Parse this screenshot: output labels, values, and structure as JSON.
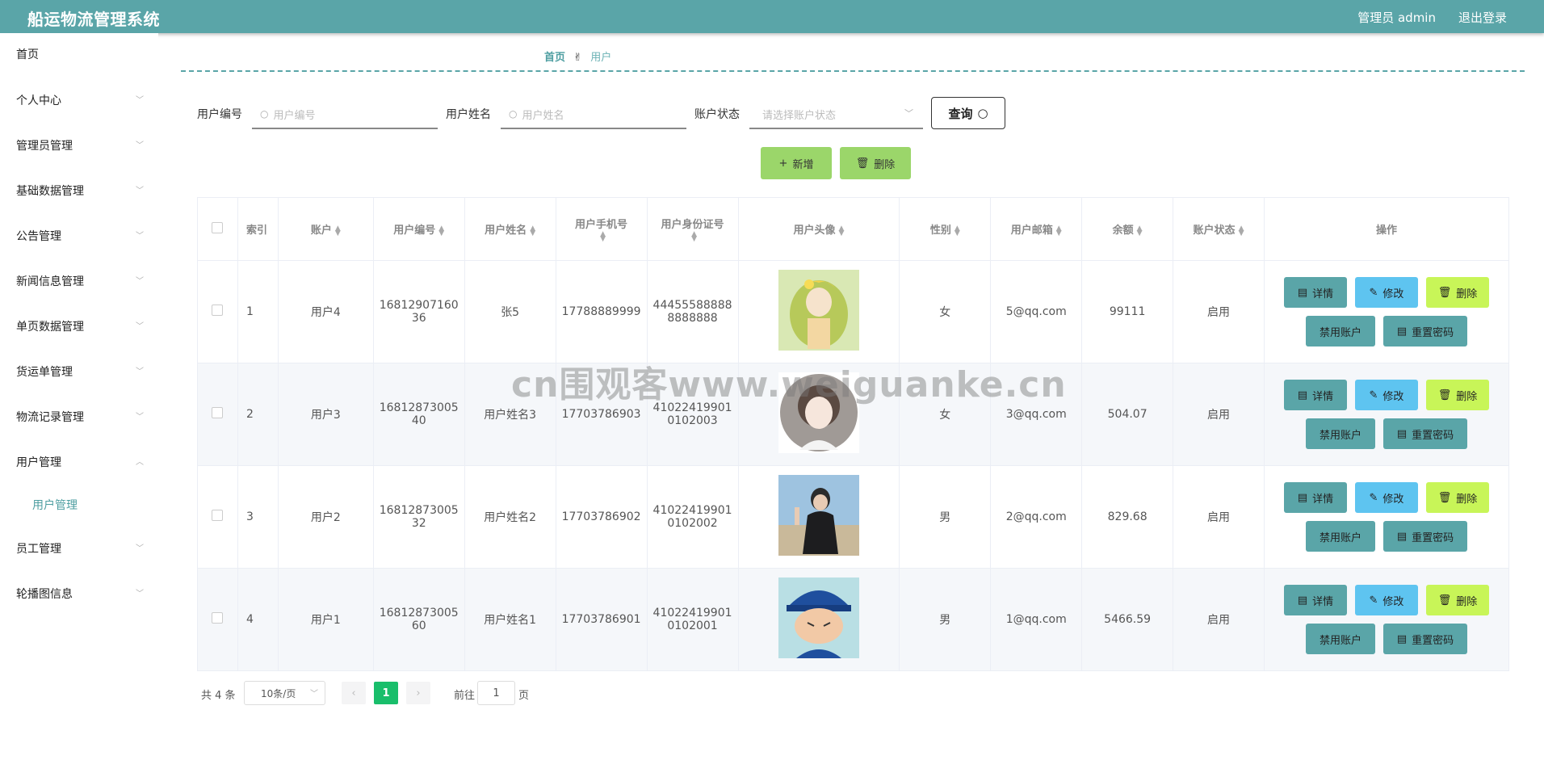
{
  "header": {
    "title": "船运物流管理系统",
    "admin": "管理员 admin",
    "logout": "退出登录"
  },
  "sidebar": {
    "items": [
      {
        "label": "首页",
        "chevron": ""
      },
      {
        "label": "个人中心",
        "chevron": "﹀"
      },
      {
        "label": "管理员管理",
        "chevron": "﹀"
      },
      {
        "label": "基础数据管理",
        "chevron": "﹀"
      },
      {
        "label": "公告管理",
        "chevron": "﹀"
      },
      {
        "label": "新闻信息管理",
        "chevron": "﹀"
      },
      {
        "label": "单页数据管理",
        "chevron": "﹀"
      },
      {
        "label": "货运单管理",
        "chevron": "﹀"
      },
      {
        "label": "物流记录管理",
        "chevron": "﹀"
      },
      {
        "label": "用户管理",
        "chevron": "︿"
      },
      {
        "label": "用户管理",
        "chevron": "",
        "sub": true
      },
      {
        "label": "员工管理",
        "chevron": "﹀"
      },
      {
        "label": "轮播图信息",
        "chevron": "﹀"
      }
    ]
  },
  "breadcrumb": {
    "home": "首页",
    "current": "用户"
  },
  "search": {
    "user_no_label": "用户编号",
    "user_no_placeholder": "用户编号",
    "user_name_label": "用户姓名",
    "user_name_placeholder": "用户姓名",
    "status_label": "账户状态",
    "status_placeholder": "请选择账户状态",
    "query": "查询"
  },
  "actions": {
    "add": "新增",
    "delete": "删除"
  },
  "table": {
    "headers": [
      "索引",
      "账户",
      "用户编号",
      "用户姓名",
      "用户手机号",
      "用户身份证号",
      "用户头像",
      "性别",
      "用户邮箱",
      "余额",
      "账户状态",
      "操作"
    ],
    "rows": [
      {
        "index": "1",
        "account": "用户4",
        "user_no_1": "16812907160",
        "user_no_2": "36",
        "name": "张5",
        "phone": "17788889999",
        "id_1": "44455588888",
        "id_2": "8888888",
        "gender": "女",
        "email": "5@qq.com",
        "balance": "99111",
        "status": "启用"
      },
      {
        "index": "2",
        "account": "用户3",
        "user_no_1": "16812873005",
        "user_no_2": "40",
        "name": "用户姓名3",
        "phone": "17703786903",
        "id_1": "41022419901",
        "id_2": "0102003",
        "gender": "女",
        "email": "3@qq.com",
        "balance": "504.07",
        "status": "启用"
      },
      {
        "index": "3",
        "account": "用户2",
        "user_no_1": "16812873005",
        "user_no_2": "32",
        "name": "用户姓名2",
        "phone": "17703786902",
        "id_1": "41022419901",
        "id_2": "0102002",
        "gender": "男",
        "email": "2@qq.com",
        "balance": "829.68",
        "status": "启用"
      },
      {
        "index": "4",
        "account": "用户1",
        "user_no_1": "16812873005",
        "user_no_2": "60",
        "name": "用户姓名1",
        "phone": "17703786901",
        "id_1": "41022419901",
        "id_2": "0102001",
        "gender": "男",
        "email": "1@qq.com",
        "balance": "5466.59",
        "status": "启用"
      }
    ],
    "ops": {
      "detail": "详情",
      "edit": "修改",
      "delete": "删除",
      "disable": "禁用账户",
      "reset": "重置密码"
    }
  },
  "pagination": {
    "total": "共 4 条",
    "page_size": "10条/页",
    "current": "1",
    "goto": "前往",
    "goto_value": "1",
    "page": "页"
  },
  "watermark": "cn围观客www.weiguanke.cn",
  "colors": {
    "header": "#5aa5a8",
    "accent": "#4e9ea1",
    "add_button": "#9bd66a",
    "edit_button": "#5ec4f0",
    "delete_button": "#c8f558",
    "page_current": "#19be6b"
  }
}
